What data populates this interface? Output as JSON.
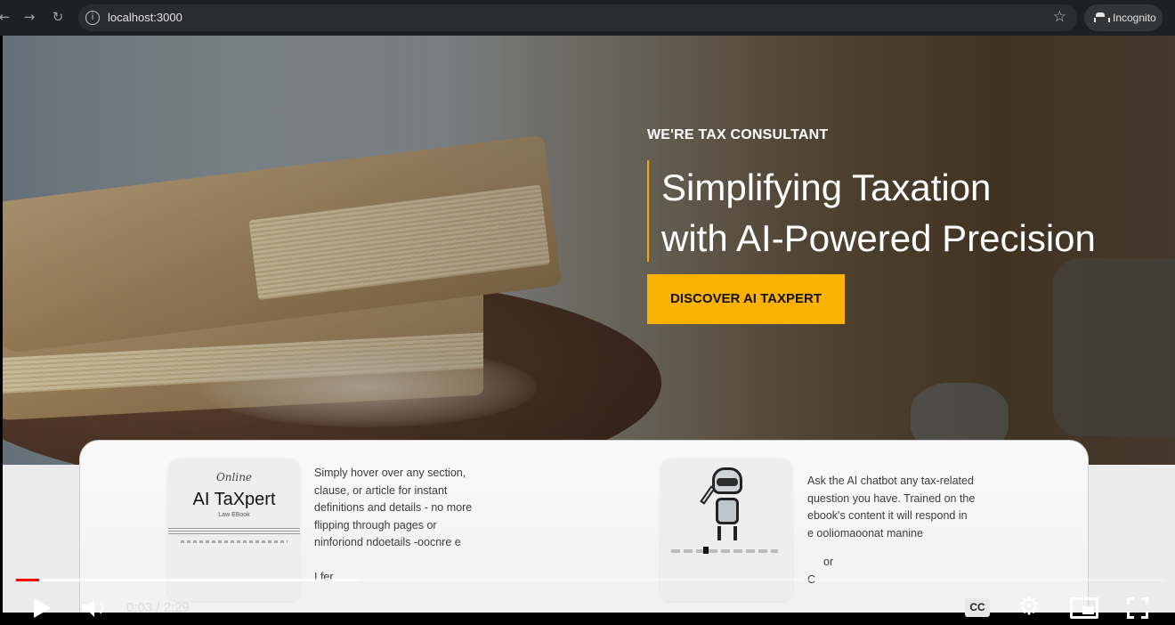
{
  "browser": {
    "url": "localhost:3000",
    "incognito_label": "Incognito",
    "icons": [
      "back-icon",
      "forward-icon",
      "reload-icon",
      "info-icon",
      "star-icon",
      "incognito-icon"
    ]
  },
  "hero": {
    "eyebrow": "WE'RE TAX CONSULTANT",
    "headline_line1": "Simplifying Taxation",
    "headline_line2": "with AI-Powered Precision",
    "cta_label": "DISCOVER AI TAXPERT",
    "accent_color": "#fcb200"
  },
  "features": [
    {
      "thumb_script": "Online",
      "thumb_title": "AI TaXpert",
      "thumb_subtitle": "Law EBook",
      "lines": [
        "Simply hover over any section,",
        "clause, or article for instant",
        "definitions and details - no more",
        "flipping through pages or",
        "ninforiond ndoetails -oocnre e",
        "",
        "I fer"
      ]
    },
    {
      "lines": [
        "Ask the AI chatbot any tax-related",
        "question you have. Trained on the",
        "ebook's content it will respond in",
        "e ooliomaoonat manine",
        "",
        "or",
        "C"
      ]
    }
  ],
  "video": {
    "current_time": "0:03",
    "duration": "2:29",
    "time_display": "0:03 / 2:29",
    "played_fraction": 0.02,
    "buffered_fraction": 0.3,
    "cc_label": "CC",
    "progress_color": "#ff0000"
  }
}
